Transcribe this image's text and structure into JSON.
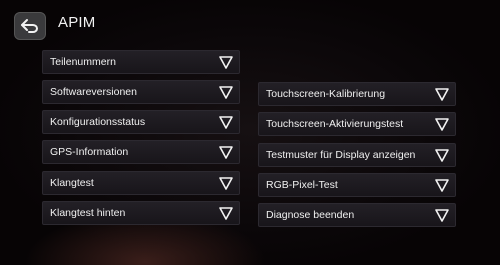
{
  "header": {
    "title": "APIM",
    "back_icon": "back-arrow-icon"
  },
  "left_items": [
    {
      "label": "Teilenummern"
    },
    {
      "label": "Softwareversionen"
    },
    {
      "label": "Konfigurationsstatus"
    },
    {
      "label": "GPS-Information"
    },
    {
      "label": "Klangtest"
    },
    {
      "label": "Klangtest hinten"
    }
  ],
  "right_items": [
    {
      "label": "Touchscreen-Kalibrierung"
    },
    {
      "label": "Touchscreen-Aktivierungstest"
    },
    {
      "label": "Testmuster für Display anzeigen"
    },
    {
      "label": "RGB-Pixel-Test"
    },
    {
      "label": "Diagnose beenden"
    }
  ],
  "dropdown_icon": "triangle-down-icon"
}
